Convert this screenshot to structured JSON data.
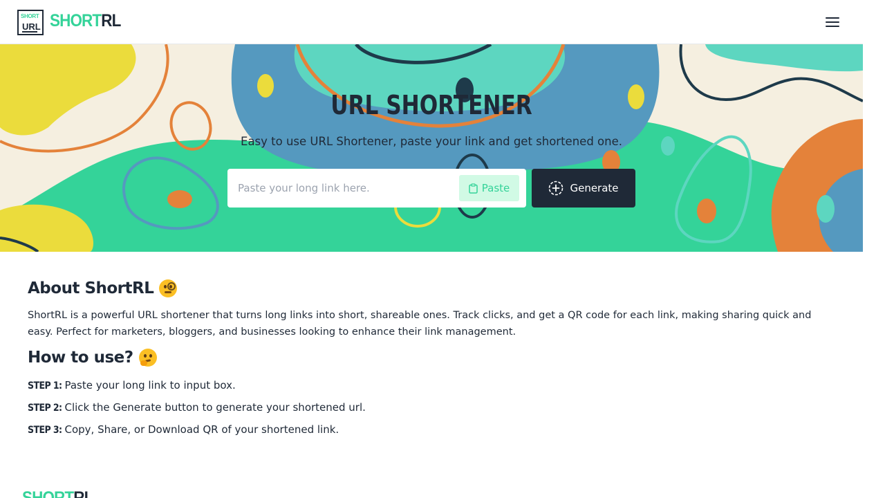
{
  "header": {
    "logo_top": "SHORT",
    "logo_bottom": "URL",
    "logo_text_a": "SHORT",
    "logo_text_b": "RL",
    "menu_icon": "hamburger-menu-icon"
  },
  "hero": {
    "title": "URL SHORTENER",
    "subtitle": "Easy to use URL Shortener, paste your link and get shortened one.",
    "input_placeholder": "Paste your long link here.",
    "input_value": "",
    "paste_label": "Paste",
    "paste_icon": "clipboard-icon",
    "generate_label": "Generate",
    "generate_icon": "plus-circle-icon"
  },
  "about": {
    "title": "About ShortRL",
    "title_emoji": "🧐",
    "text": "ShortRL is a powerful URL shortener that turns long links into short, shareable ones. Track clicks, and get a QR code for each link, making sharing quick and easy. Perfect for marketers, bloggers, and businesses looking to enhance their link management."
  },
  "how_to": {
    "title": "How to use?",
    "title_emoji": "🤔",
    "steps": [
      {
        "label": "STEP 1:",
        "text": "Paste your long link to input box."
      },
      {
        "label": "STEP 2:",
        "text": "Click the Generate button to generate your shortened url."
      },
      {
        "label": "STEP 3:",
        "text": "Copy, Share, or Download QR of your shortened link."
      }
    ]
  },
  "footer": {
    "logo_text_a": "SHORT",
    "logo_text_b": "RL"
  },
  "colors": {
    "brand_green": "#34d399",
    "dark": "#1f2937",
    "teal": "#5dd6c0",
    "blue": "#5599bf",
    "orange": "#e4823a",
    "yellow": "#ebdc3c",
    "cream": "#f5efe0"
  }
}
